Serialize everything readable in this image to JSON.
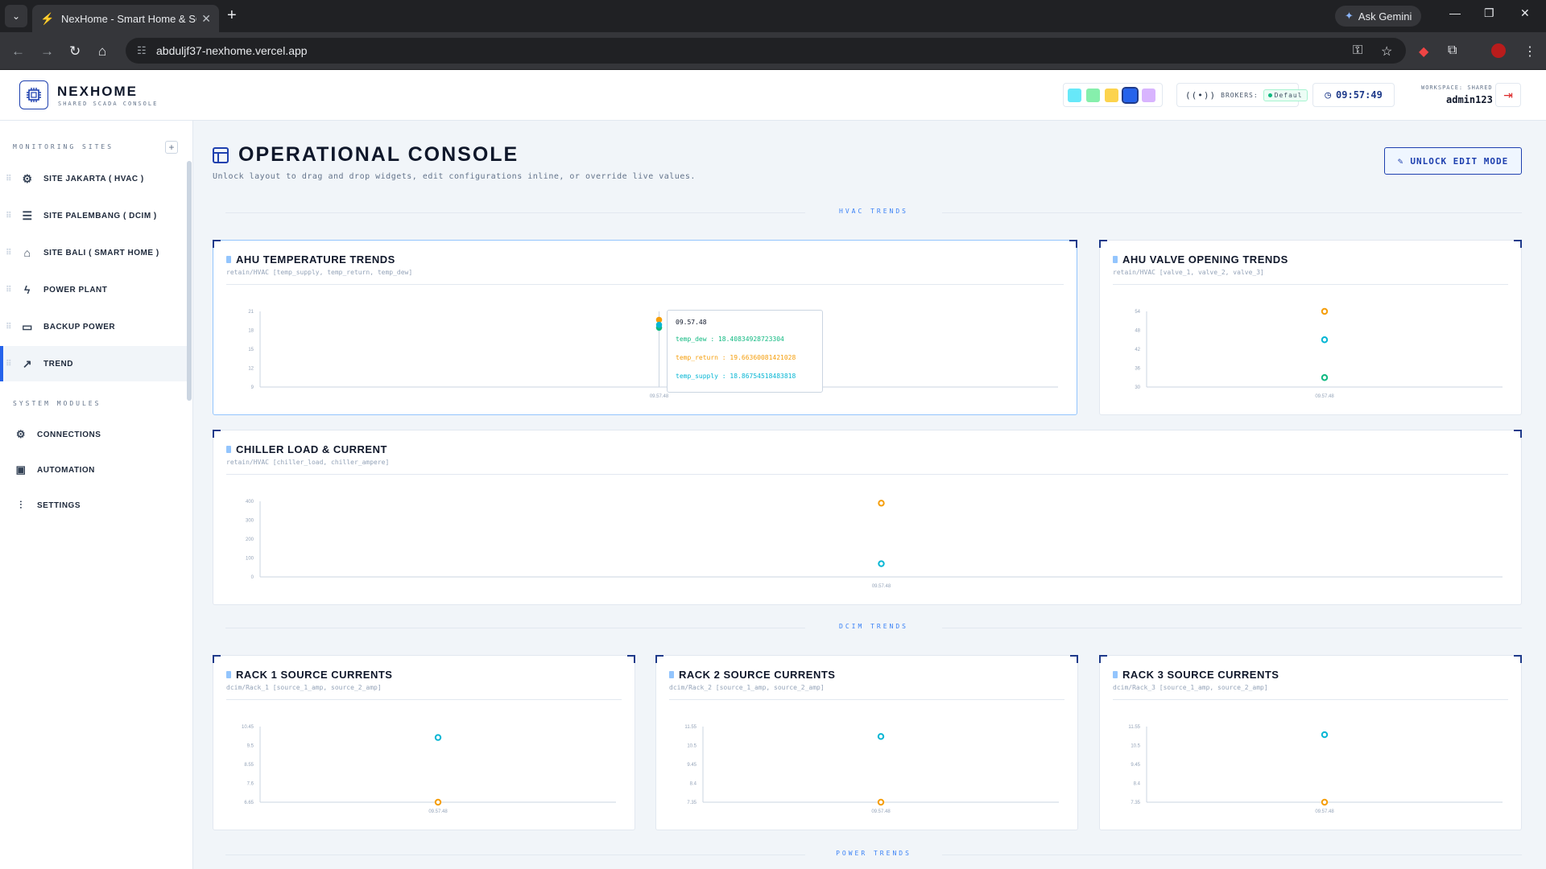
{
  "browser": {
    "tab_title": "NexHome - Smart Home & SCADA",
    "url": "abduljf37-nexhome.vercel.app",
    "gemini_label": "Ask Gemini"
  },
  "header": {
    "brand": "NEXHOME",
    "brand_sub": "SHARED SCADA CONSOLE",
    "swatches": [
      "#67e8f9",
      "#86efac",
      "#fcd34d",
      "#2563eb",
      "#d8b4fe"
    ],
    "brokers_label": "BROKERS:",
    "broker_value": "Defaul",
    "clock": "09:57:49",
    "workspace_label": "WORKSPACE: SHARED",
    "user": "admin123"
  },
  "sidebar": {
    "monitoring_title": "MONITORING SITES",
    "sites": [
      {
        "label": "SITE JAKARTA ( HVAC )",
        "icon": "chip-icon"
      },
      {
        "label": "SITE PALEMBANG ( DCIM )",
        "icon": "server-icon"
      },
      {
        "label": "SITE BALI ( SMART HOME )",
        "icon": "home-icon"
      },
      {
        "label": "POWER PLANT",
        "icon": "bolt-icon"
      },
      {
        "label": "BACKUP POWER",
        "icon": "battery-icon"
      },
      {
        "label": "TREND",
        "icon": "trend-icon",
        "active": true
      }
    ],
    "modules_title": "SYSTEM MODULES",
    "modules": [
      {
        "label": "CONNECTIONS",
        "icon": "gear-icon"
      },
      {
        "label": "AUTOMATION",
        "icon": "cpu-icon"
      },
      {
        "label": "SETTINGS",
        "icon": "sliders-icon"
      }
    ]
  },
  "main": {
    "title": "OPERATIONAL CONSOLE",
    "subtitle": "Unlock layout to drag and drop widgets, edit configurations inline, or override live values.",
    "unlock_label": "UNLOCK EDIT MODE",
    "sections": [
      "HVAC TRENDS",
      "DCIM TRENDS",
      "POWER TRENDS"
    ]
  },
  "cards": [
    {
      "title": "AHU TEMPERATURE TRENDS",
      "subtitle": "retain/HVAC [temp_supply, temp_return, temp_dew]"
    },
    {
      "title": "AHU VALVE OPENING TRENDS",
      "subtitle": "retain/HVAC [valve_1, valve_2, valve_3]"
    },
    {
      "title": "CHILLER LOAD & CURRENT",
      "subtitle": "retain/HVAC [chiller_load, chiller_ampere]"
    },
    {
      "title": "RACK 1 SOURCE CURRENTS",
      "subtitle": "dcim/Rack_1 [source_1_amp, source_2_amp]"
    },
    {
      "title": "RACK 2 SOURCE CURRENTS",
      "subtitle": "dcim/Rack_2 [source_1_amp, source_2_amp]"
    },
    {
      "title": "RACK 3 SOURCE CURRENTS",
      "subtitle": "dcim/Rack_3 [source_1_amp, source_2_amp]"
    }
  ],
  "tooltip": {
    "time": "09.57.48",
    "rows": [
      {
        "label": "temp_dew : 18.40834928723304",
        "color": "#10b981"
      },
      {
        "label": "temp_return : 19.66360081421028",
        "color": "#f59e0b"
      },
      {
        "label": "temp_supply : 18.86754518483818",
        "color": "#06b6d4"
      }
    ]
  },
  "chart_data": [
    {
      "type": "scatter",
      "title": "AHU TEMPERATURE TRENDS",
      "ylim": [
        9,
        21
      ],
      "yticks": [
        "9",
        "12",
        "15",
        "18",
        "21"
      ],
      "x": [
        "09.57.48"
      ],
      "series": [
        {
          "name": "temp_dew",
          "values": [
            18.41
          ],
          "color": "#10b981"
        },
        {
          "name": "temp_return",
          "values": [
            19.66
          ],
          "color": "#f59e0b"
        },
        {
          "name": "temp_supply",
          "values": [
            18.87
          ],
          "color": "#06b6d4"
        }
      ]
    },
    {
      "type": "scatter",
      "title": "AHU VALVE OPENING TRENDS",
      "ylim": [
        30,
        54
      ],
      "yticks": [
        "30",
        "36",
        "42",
        "48",
        "54"
      ],
      "x": [
        "09.57.48"
      ],
      "series": [
        {
          "values": [
            54
          ],
          "color": "#f59e0b"
        },
        {
          "values": [
            45
          ],
          "color": "#06b6d4"
        },
        {
          "values": [
            33
          ],
          "color": "#10b981"
        }
      ]
    },
    {
      "type": "scatter",
      "title": "CHILLER LOAD & CURRENT",
      "ylim": [
        0,
        400
      ],
      "yticks": [
        "0",
        "100",
        "200",
        "300",
        "400"
      ],
      "x": [
        "09.57.48"
      ],
      "series": [
        {
          "values": [
            390
          ],
          "color": "#f59e0b"
        },
        {
          "values": [
            70
          ],
          "color": "#06b6d4"
        }
      ]
    },
    {
      "type": "scatter",
      "title": "RACK 1 SOURCE CURRENTS",
      "ylim": [
        6.65,
        10.45
      ],
      "yticks": [
        "6.65",
        "7.6",
        "8.55",
        "9.5",
        "10.45"
      ],
      "x": [
        "09.57.48"
      ],
      "series": [
        {
          "values": [
            9.9
          ],
          "color": "#06b6d4"
        },
        {
          "values": [
            6.65
          ],
          "color": "#f59e0b"
        }
      ]
    },
    {
      "type": "scatter",
      "title": "RACK 2 SOURCE CURRENTS",
      "ylim": [
        7.35,
        11.55
      ],
      "yticks": [
        "7.35",
        "8.4",
        "9.45",
        "10.5",
        "11.55"
      ],
      "x": [
        "09.57.48"
      ],
      "series": [
        {
          "values": [
            11.0
          ],
          "color": "#06b6d4"
        },
        {
          "values": [
            7.35
          ],
          "color": "#f59e0b"
        }
      ]
    },
    {
      "type": "scatter",
      "title": "RACK 3 SOURCE CURRENTS",
      "ylim": [
        7.35,
        11.55
      ],
      "yticks": [
        "7.35",
        "8.4",
        "9.45",
        "10.5",
        "11.55"
      ],
      "x": [
        "09.57.48"
      ],
      "series": [
        {
          "values": [
            11.1
          ],
          "color": "#06b6d4"
        },
        {
          "values": [
            7.35
          ],
          "color": "#f59e0b"
        }
      ]
    }
  ]
}
